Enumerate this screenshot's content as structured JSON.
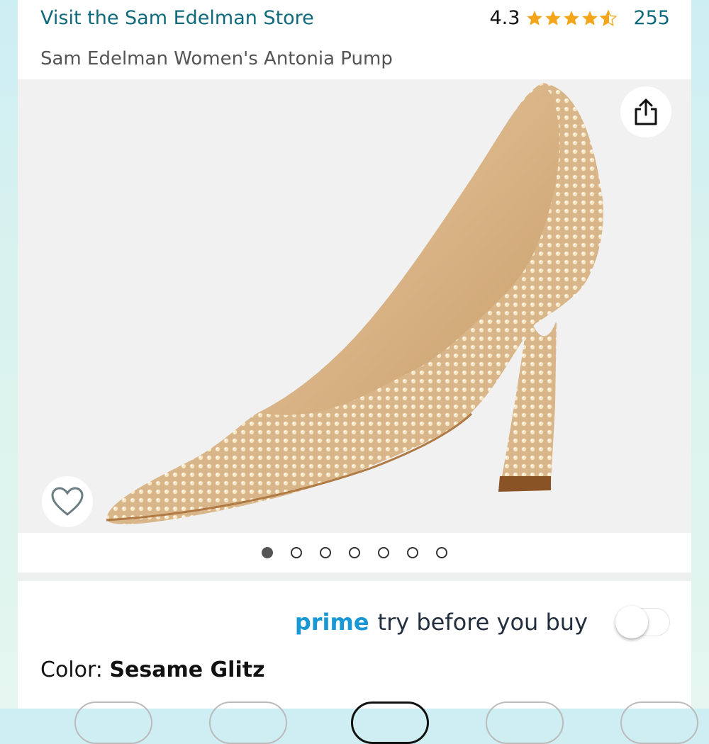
{
  "header": {
    "store_link": "Visit the Sam Edelman Store",
    "rating_value": "4.3",
    "rating_stars": 4.3,
    "rating_count": "255",
    "product_title": "Sam Edelman Women's Antonia Pump"
  },
  "gallery": {
    "image_name": "gold-rhinestone-pump",
    "image_count": 7,
    "active_index": 0
  },
  "prime": {
    "brand": "prime",
    "text": "try before you buy",
    "toggle_on": false
  },
  "color": {
    "label": "Color: ",
    "value": "Sesame Glitz"
  },
  "colors": {
    "link": "#0f6b7c",
    "prime_blue": "#1a98d5",
    "star": "#f3a619"
  }
}
